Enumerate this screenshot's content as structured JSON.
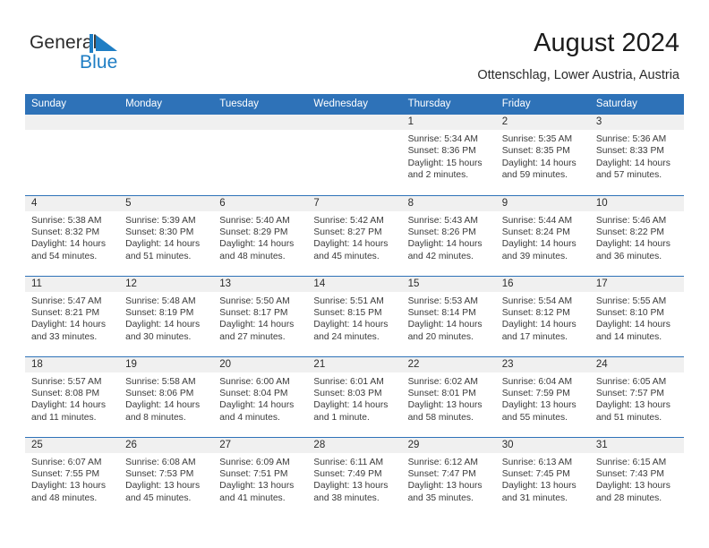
{
  "brand": {
    "name_part1": "General",
    "name_part2": "Blue",
    "logo_icon": "general-blue-triangle-logo"
  },
  "header": {
    "title": "August 2024",
    "location": "Ottenschlag, Lower Austria, Austria"
  },
  "colors": {
    "header_blue": "#2E72B8",
    "brand_blue": "#1F7EC4",
    "daynum_band": "#F0F0F0",
    "text": "#2B2B2B"
  },
  "calendar": {
    "weekday_headers": [
      "Sunday",
      "Monday",
      "Tuesday",
      "Wednesday",
      "Thursday",
      "Friday",
      "Saturday"
    ],
    "weeks": [
      [
        {
          "day": "",
          "empty": true
        },
        {
          "day": "",
          "empty": true
        },
        {
          "day": "",
          "empty": true
        },
        {
          "day": "",
          "empty": true
        },
        {
          "day": "1",
          "sunrise": "Sunrise: 5:34 AM",
          "sunset": "Sunset: 8:36 PM",
          "daylight_line1": "Daylight: 15 hours",
          "daylight_line2": "and 2 minutes."
        },
        {
          "day": "2",
          "sunrise": "Sunrise: 5:35 AM",
          "sunset": "Sunset: 8:35 PM",
          "daylight_line1": "Daylight: 14 hours",
          "daylight_line2": "and 59 minutes."
        },
        {
          "day": "3",
          "sunrise": "Sunrise: 5:36 AM",
          "sunset": "Sunset: 8:33 PM",
          "daylight_line1": "Daylight: 14 hours",
          "daylight_line2": "and 57 minutes."
        }
      ],
      [
        {
          "day": "4",
          "sunrise": "Sunrise: 5:38 AM",
          "sunset": "Sunset: 8:32 PM",
          "daylight_line1": "Daylight: 14 hours",
          "daylight_line2": "and 54 minutes."
        },
        {
          "day": "5",
          "sunrise": "Sunrise: 5:39 AM",
          "sunset": "Sunset: 8:30 PM",
          "daylight_line1": "Daylight: 14 hours",
          "daylight_line2": "and 51 minutes."
        },
        {
          "day": "6",
          "sunrise": "Sunrise: 5:40 AM",
          "sunset": "Sunset: 8:29 PM",
          "daylight_line1": "Daylight: 14 hours",
          "daylight_line2": "and 48 minutes."
        },
        {
          "day": "7",
          "sunrise": "Sunrise: 5:42 AM",
          "sunset": "Sunset: 8:27 PM",
          "daylight_line1": "Daylight: 14 hours",
          "daylight_line2": "and 45 minutes."
        },
        {
          "day": "8",
          "sunrise": "Sunrise: 5:43 AM",
          "sunset": "Sunset: 8:26 PM",
          "daylight_line1": "Daylight: 14 hours",
          "daylight_line2": "and 42 minutes."
        },
        {
          "day": "9",
          "sunrise": "Sunrise: 5:44 AM",
          "sunset": "Sunset: 8:24 PM",
          "daylight_line1": "Daylight: 14 hours",
          "daylight_line2": "and 39 minutes."
        },
        {
          "day": "10",
          "sunrise": "Sunrise: 5:46 AM",
          "sunset": "Sunset: 8:22 PM",
          "daylight_line1": "Daylight: 14 hours",
          "daylight_line2": "and 36 minutes."
        }
      ],
      [
        {
          "day": "11",
          "sunrise": "Sunrise: 5:47 AM",
          "sunset": "Sunset: 8:21 PM",
          "daylight_line1": "Daylight: 14 hours",
          "daylight_line2": "and 33 minutes."
        },
        {
          "day": "12",
          "sunrise": "Sunrise: 5:48 AM",
          "sunset": "Sunset: 8:19 PM",
          "daylight_line1": "Daylight: 14 hours",
          "daylight_line2": "and 30 minutes."
        },
        {
          "day": "13",
          "sunrise": "Sunrise: 5:50 AM",
          "sunset": "Sunset: 8:17 PM",
          "daylight_line1": "Daylight: 14 hours",
          "daylight_line2": "and 27 minutes."
        },
        {
          "day": "14",
          "sunrise": "Sunrise: 5:51 AM",
          "sunset": "Sunset: 8:15 PM",
          "daylight_line1": "Daylight: 14 hours",
          "daylight_line2": "and 24 minutes."
        },
        {
          "day": "15",
          "sunrise": "Sunrise: 5:53 AM",
          "sunset": "Sunset: 8:14 PM",
          "daylight_line1": "Daylight: 14 hours",
          "daylight_line2": "and 20 minutes."
        },
        {
          "day": "16",
          "sunrise": "Sunrise: 5:54 AM",
          "sunset": "Sunset: 8:12 PM",
          "daylight_line1": "Daylight: 14 hours",
          "daylight_line2": "and 17 minutes."
        },
        {
          "day": "17",
          "sunrise": "Sunrise: 5:55 AM",
          "sunset": "Sunset: 8:10 PM",
          "daylight_line1": "Daylight: 14 hours",
          "daylight_line2": "and 14 minutes."
        }
      ],
      [
        {
          "day": "18",
          "sunrise": "Sunrise: 5:57 AM",
          "sunset": "Sunset: 8:08 PM",
          "daylight_line1": "Daylight: 14 hours",
          "daylight_line2": "and 11 minutes."
        },
        {
          "day": "19",
          "sunrise": "Sunrise: 5:58 AM",
          "sunset": "Sunset: 8:06 PM",
          "daylight_line1": "Daylight: 14 hours",
          "daylight_line2": "and 8 minutes."
        },
        {
          "day": "20",
          "sunrise": "Sunrise: 6:00 AM",
          "sunset": "Sunset: 8:04 PM",
          "daylight_line1": "Daylight: 14 hours",
          "daylight_line2": "and 4 minutes."
        },
        {
          "day": "21",
          "sunrise": "Sunrise: 6:01 AM",
          "sunset": "Sunset: 8:03 PM",
          "daylight_line1": "Daylight: 14 hours",
          "daylight_line2": "and 1 minute."
        },
        {
          "day": "22",
          "sunrise": "Sunrise: 6:02 AM",
          "sunset": "Sunset: 8:01 PM",
          "daylight_line1": "Daylight: 13 hours",
          "daylight_line2": "and 58 minutes."
        },
        {
          "day": "23",
          "sunrise": "Sunrise: 6:04 AM",
          "sunset": "Sunset: 7:59 PM",
          "daylight_line1": "Daylight: 13 hours",
          "daylight_line2": "and 55 minutes."
        },
        {
          "day": "24",
          "sunrise": "Sunrise: 6:05 AM",
          "sunset": "Sunset: 7:57 PM",
          "daylight_line1": "Daylight: 13 hours",
          "daylight_line2": "and 51 minutes."
        }
      ],
      [
        {
          "day": "25",
          "sunrise": "Sunrise: 6:07 AM",
          "sunset": "Sunset: 7:55 PM",
          "daylight_line1": "Daylight: 13 hours",
          "daylight_line2": "and 48 minutes."
        },
        {
          "day": "26",
          "sunrise": "Sunrise: 6:08 AM",
          "sunset": "Sunset: 7:53 PM",
          "daylight_line1": "Daylight: 13 hours",
          "daylight_line2": "and 45 minutes."
        },
        {
          "day": "27",
          "sunrise": "Sunrise: 6:09 AM",
          "sunset": "Sunset: 7:51 PM",
          "daylight_line1": "Daylight: 13 hours",
          "daylight_line2": "and 41 minutes."
        },
        {
          "day": "28",
          "sunrise": "Sunrise: 6:11 AM",
          "sunset": "Sunset: 7:49 PM",
          "daylight_line1": "Daylight: 13 hours",
          "daylight_line2": "and 38 minutes."
        },
        {
          "day": "29",
          "sunrise": "Sunrise: 6:12 AM",
          "sunset": "Sunset: 7:47 PM",
          "daylight_line1": "Daylight: 13 hours",
          "daylight_line2": "and 35 minutes."
        },
        {
          "day": "30",
          "sunrise": "Sunrise: 6:13 AM",
          "sunset": "Sunset: 7:45 PM",
          "daylight_line1": "Daylight: 13 hours",
          "daylight_line2": "and 31 minutes."
        },
        {
          "day": "31",
          "sunrise": "Sunrise: 6:15 AM",
          "sunset": "Sunset: 7:43 PM",
          "daylight_line1": "Daylight: 13 hours",
          "daylight_line2": "and 28 minutes."
        }
      ]
    ]
  }
}
